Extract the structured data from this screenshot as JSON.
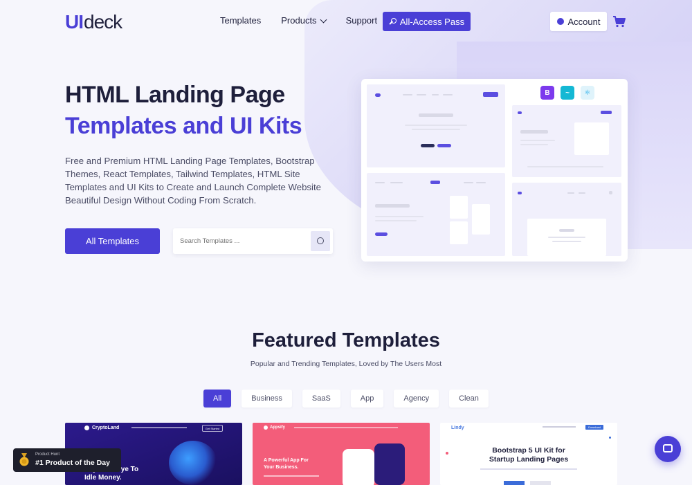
{
  "header": {
    "logo_ui": "UI",
    "logo_deck": "deck",
    "nav": [
      {
        "label": "Templates"
      },
      {
        "label": "Products"
      },
      {
        "label": "Support"
      }
    ],
    "pass_label": "All-Access Pass",
    "account_label": "Account"
  },
  "hero": {
    "title_line1": "HTML Landing Page",
    "title_line2": "Templates and UI Kits",
    "description": "Free and Premium HTML Landing Page Templates, Bootstrap Themes, React Templates, Tailwind Templates, HTML Site Templates and UI Kits to Create and Launch Complete Website Beautiful Design Without Coding From Scratch.",
    "all_templates_label": "All Templates",
    "search_placeholder": "Search Templates ...",
    "tech_badges": [
      {
        "label": "B",
        "color": "#7c3aed"
      },
      {
        "label": "~",
        "color": "#14b8d4"
      },
      {
        "label": "⚛",
        "color": "#0ea5e9"
      }
    ]
  },
  "featured": {
    "title": "Featured Templates",
    "subtitle": "Popular and Trending Templates, Loved by The Users Most",
    "filters": [
      "All",
      "Business",
      "SaaS",
      "App",
      "Agency",
      "Clean"
    ],
    "cards": [
      {
        "brand": "CryptoLand",
        "headline_line1": "Say Goodbye To",
        "headline_line2": "Idle Money.",
        "cta": "Get Started"
      },
      {
        "brand": "Appsify",
        "headline_line1": "A Powerful App For",
        "headline_line2": "Your Business."
      },
      {
        "brand": "Lindy",
        "headline_line1": "Bootstrap 5 UI Kit for",
        "headline_line2": "Startup Landing Pages",
        "cta": "Download"
      }
    ]
  },
  "product_hunt": {
    "label": "Product Hunt",
    "title": "#1 Product of the Day"
  }
}
